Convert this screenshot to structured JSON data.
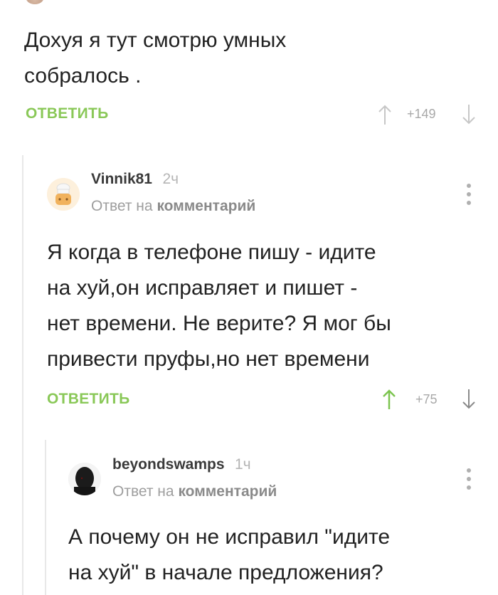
{
  "comment1": {
    "text_lines": [
      "Дохуя я тут смотрю умных",
      "собралось ."
    ],
    "reply_label": "ОТВЕТИТЬ",
    "votes": "+149"
  },
  "comment2": {
    "username": "Vinnik81",
    "time": "2ч",
    "reply_to_prefix": "Ответ на",
    "reply_to_link": "комментарий",
    "text_lines": [
      "Я когда в телефоне пишу - идите",
      "на хуй,он исправляет и пишет -",
      "нет времени. Не верите? Я мог бы",
      "привести пруфы,но нет времени"
    ],
    "reply_label": "ОТВЕТИТЬ",
    "votes": "+75",
    "upvoted_color": "#7cc44f"
  },
  "comment3": {
    "username": "beyondswamps",
    "time": "1ч",
    "reply_to_prefix": "Ответ на",
    "reply_to_link": "комментарий",
    "text_lines": [
      "А почему он не исправил \"идите",
      "на хуй\" в начале предложения?"
    ]
  },
  "colors": {
    "accent": "#8ac858",
    "text": "#222222",
    "muted": "#a8a8a8"
  }
}
